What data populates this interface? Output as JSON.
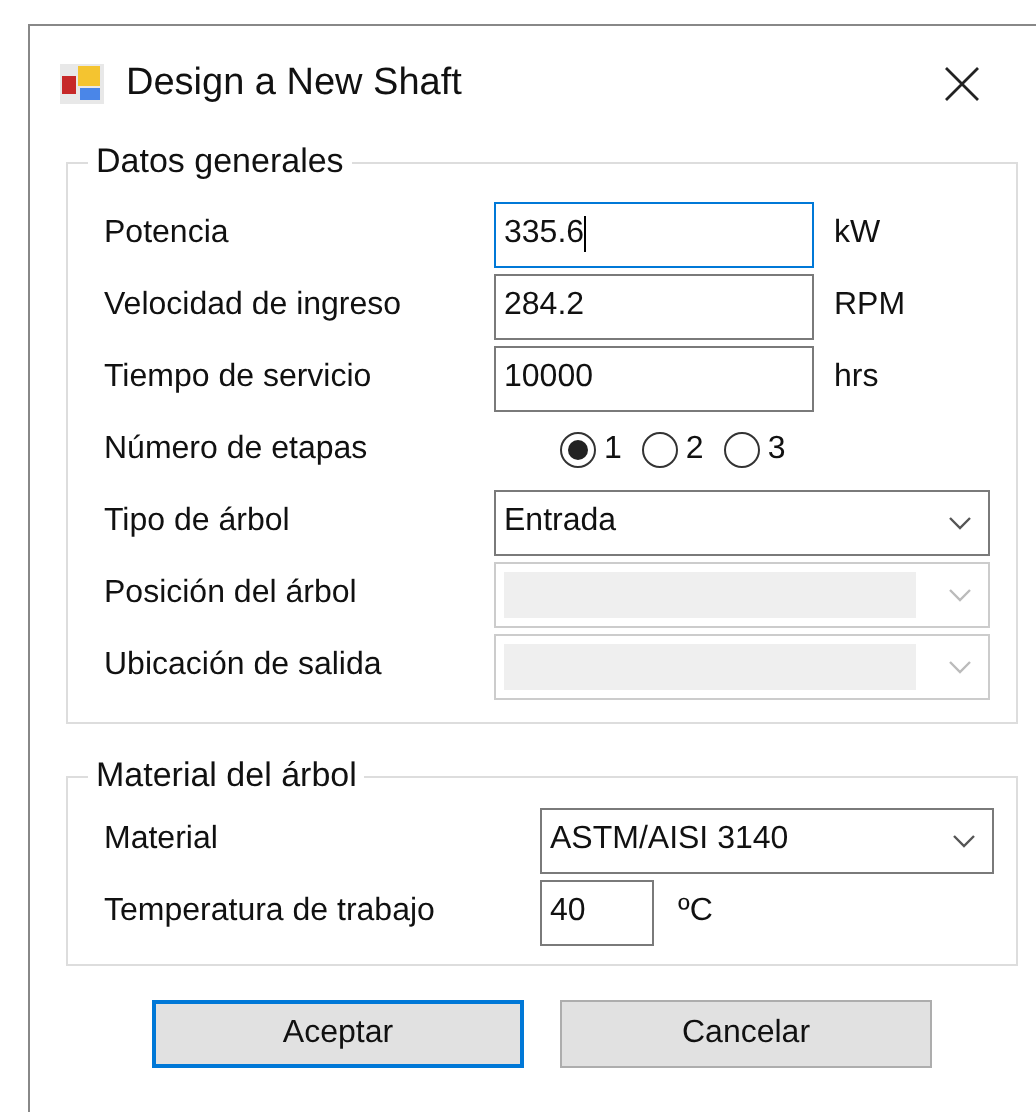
{
  "window": {
    "title": "Design a New Shaft"
  },
  "groups": [
    {
      "title": "Datos generales",
      "fields": [
        {
          "kind": "text",
          "label": "Potencia",
          "value": "335.6",
          "unit": "kW",
          "focused": true
        },
        {
          "kind": "text",
          "label": "Velocidad de ingreso",
          "value": "284.2",
          "unit": "RPM",
          "focused": false
        },
        {
          "kind": "text",
          "label": "Tiempo de servicio",
          "value": "10000",
          "unit": "hrs",
          "focused": false
        },
        {
          "kind": "radio",
          "label": "Número de etapas",
          "options": [
            {
              "label": "1",
              "selected": true
            },
            {
              "label": "2",
              "selected": false
            },
            {
              "label": "3",
              "selected": false
            }
          ]
        },
        {
          "kind": "combo",
          "label": "Tipo de árbol",
          "value": "Entrada",
          "disabled": false
        },
        {
          "kind": "combo",
          "label": "Posición del árbol",
          "disabled": true
        },
        {
          "kind": "combo",
          "label": "Ubicación de salida",
          "disabled": true
        }
      ]
    },
    {
      "title": "Material del árbol",
      "fields": [
        {
          "kind": "combo",
          "label": "Material",
          "value": "ASTM/AISI 3140",
          "disabled": false
        },
        {
          "kind": "short",
          "label": "Temperatura de trabajo",
          "value": "40",
          "unit": "ºC",
          "focused": false
        }
      ]
    }
  ],
  "buttons": [
    {
      "label": "Aceptar",
      "default": true
    },
    {
      "label": "Cancelar",
      "default": false
    }
  ]
}
